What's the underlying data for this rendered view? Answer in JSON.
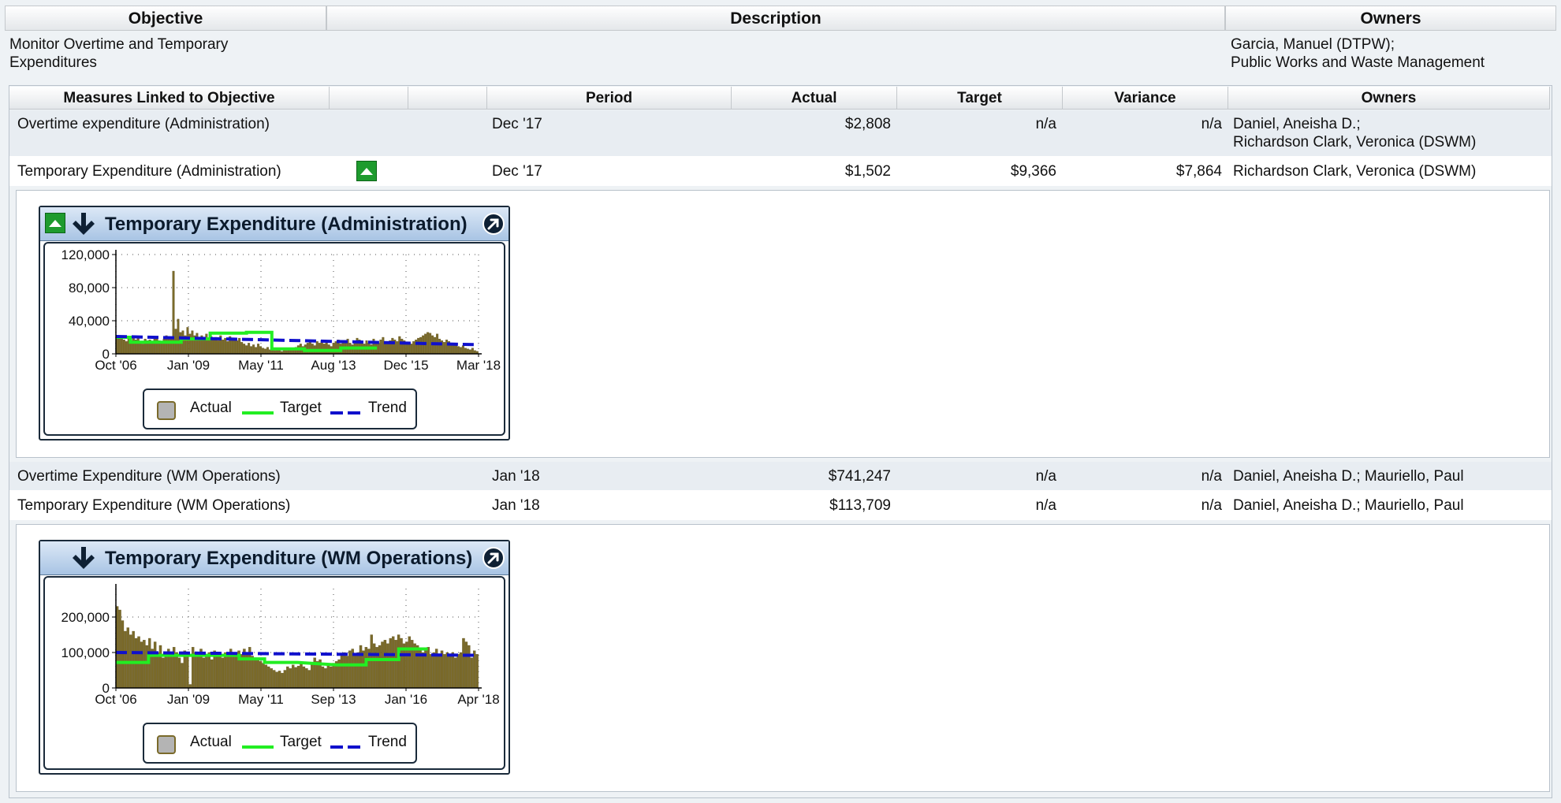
{
  "objective_table": {
    "headers": {
      "objective": "Objective",
      "description": "Description",
      "owners": "Owners"
    },
    "objective": "Monitor Overtime and Temporary Expenditures",
    "objective_line1": "Monitor Overtime and Temporary",
    "objective_line2": "Expenditures",
    "description": "",
    "owners_line1": "Garcia, Manuel (DTPW);",
    "owners_line2": "Public Works and Waste Management"
  },
  "measures_table": {
    "headers": {
      "measure": "Measures Linked to Objective",
      "period": "Period",
      "actual": "Actual",
      "target": "Target",
      "variance": "Variance",
      "owners": "Owners"
    },
    "rows": [
      {
        "measure": "Overtime expenditure (Administration)",
        "period": "Dec '17",
        "actual": "$2,808",
        "target": "n/a",
        "variance": "n/a",
        "owners_line1": "Daniel, Aneisha D.;",
        "owners_line2": "Richardson Clark, Veronica (DSWM)",
        "status": "none"
      },
      {
        "measure": "Temporary Expenditure (Administration)",
        "period": "Dec '17",
        "actual": "$1,502",
        "target": "$9,366",
        "variance": "$7,864",
        "owners_line1": "Richardson Clark, Veronica (DSWM)",
        "owners_line2": "",
        "status": "up-green"
      },
      {
        "measure": "Overtime Expenditure (WM Operations)",
        "period": "Jan '18",
        "actual": "$741,247",
        "target": "n/a",
        "variance": "n/a",
        "owners_line1": "Daniel, Aneisha D.; Mauriello, Paul",
        "owners_line2": "",
        "status": "none"
      },
      {
        "measure": "Temporary Expenditure (WM Operations)",
        "period": "Jan '18",
        "actual": "$113,709",
        "target": "n/a",
        "variance": "n/a",
        "owners_line1": "Daniel, Aneisha D.; Mauriello, Paul",
        "owners_line2": "",
        "status": "none"
      }
    ]
  },
  "widgets": [
    {
      "title": "Temporary Expenditure (Administration)",
      "status_icon": "up-green-icon",
      "trend_icon": "down-arrow-icon",
      "link_icon": "expand-arrow-icon"
    },
    {
      "title": "Temporary Expenditure (WM Operations)",
      "status_icon": "",
      "trend_icon": "down-arrow-icon",
      "link_icon": "expand-arrow-icon"
    }
  ],
  "legend": {
    "actual": "Actual",
    "target": "Target",
    "trend": "Trend"
  },
  "colors": {
    "actual_fill": "#7a6a2a",
    "actual_stroke": "#5e5120",
    "target": "#22ee22",
    "trend": "#1010cc",
    "status_green": "#1e9b2e"
  },
  "chart_data": [
    {
      "type": "bar",
      "title": "Temporary Expenditure (Administration)",
      "x_tick_labels": [
        "Oct '06",
        "Jan '09",
        "May '11",
        "Aug '13",
        "Dec '15",
        "Mar '18"
      ],
      "y_tick_labels": [
        "0",
        "40,000",
        "80,000",
        "120,000"
      ],
      "ylim": [
        0,
        120000
      ],
      "grid": true,
      "legend_position": "bottom",
      "series": [
        {
          "name": "Actual",
          "kind": "bar",
          "values": [
            21000,
            19000,
            22000,
            17000,
            15000,
            18000,
            16000,
            19000,
            17000,
            20000,
            14000,
            12000,
            18000,
            16000,
            17000,
            15000,
            19000,
            21000,
            16000,
            14000,
            18000,
            22000,
            20000,
            19000,
            100000,
            30000,
            42000,
            26000,
            28000,
            22000,
            32000,
            24000,
            28000,
            22000,
            25000,
            18000,
            22000,
            20000,
            24000,
            19000,
            21000,
            18000,
            20000,
            16000,
            22000,
            17000,
            19000,
            15000,
            21000,
            18000,
            17000,
            16000,
            19000,
            14000,
            12000,
            10000,
            13000,
            9000,
            11000,
            8000,
            12000,
            9000,
            7000,
            6000,
            8000,
            5000,
            6000,
            4000,
            7000,
            5000,
            3000,
            6000,
            4000,
            5000,
            7000,
            6000,
            8000,
            10000,
            12000,
            9000,
            11000,
            13000,
            14000,
            12000,
            10000,
            15000,
            13000,
            16000,
            12000,
            14000,
            11000,
            9000,
            13000,
            15000,
            17000,
            12000,
            14000,
            16000,
            18000,
            13000,
            11000,
            15000,
            19000,
            17000,
            14000,
            12000,
            16000,
            13000,
            11000,
            18000,
            15000,
            13000,
            17000,
            20000,
            14000,
            12000,
            16000,
            19000,
            17000,
            15000,
            21000,
            18000,
            16000,
            14000,
            13000,
            12000,
            15000,
            17000,
            19000,
            20000,
            22000,
            24000,
            26000,
            25000,
            22000,
            20000,
            24000,
            18000,
            16000,
            14000,
            17000,
            15000,
            13000,
            12000,
            11000,
            9000,
            8000,
            10000,
            7000,
            6000,
            5000,
            7000,
            4000,
            3000
          ]
        },
        {
          "name": "Target",
          "kind": "step-line",
          "points": [
            [
              0,
              20000
            ],
            [
              0.04,
              20000
            ],
            [
              0.04,
              14000
            ],
            [
              0.18,
              14000
            ],
            [
              0.18,
              18000
            ],
            [
              0.26,
              18000
            ],
            [
              0.26,
              25000
            ],
            [
              0.36,
              25000
            ],
            [
              0.36,
              26000
            ],
            [
              0.43,
              26000
            ],
            [
              0.43,
              6000
            ],
            [
              0.52,
              6000
            ],
            [
              0.52,
              4000
            ],
            [
              0.62,
              4000
            ],
            [
              0.62,
              7000
            ],
            [
              0.72,
              7000
            ]
          ]
        },
        {
          "name": "Trend",
          "kind": "dashed-line",
          "points": [
            [
              0,
              21000
            ],
            [
              1,
              11000
            ]
          ]
        }
      ]
    },
    {
      "type": "bar",
      "title": "Temporary Expenditure (WM Operations)",
      "x_tick_labels": [
        "Oct '06",
        "Jan '09",
        "May '11",
        "Sep '13",
        "Jan '16",
        "Apr '18"
      ],
      "y_tick_labels": [
        "0",
        "100,000",
        "200,000"
      ],
      "ylim": [
        0,
        280000
      ],
      "grid": true,
      "legend_position": "bottom",
      "series": [
        {
          "name": "Actual",
          "kind": "bar",
          "values": [
            230000,
            220000,
            190000,
            160000,
            170000,
            150000,
            160000,
            140000,
            145000,
            130000,
            135000,
            120000,
            140000,
            110000,
            130000,
            100000,
            120000,
            85000,
            95000,
            110000,
            90000,
            115000,
            100000,
            85000,
            70000,
            105000,
            95000,
            10000,
            115000,
            100000,
            90000,
            110000,
            85000,
            95000,
            100000,
            80000,
            105000,
            90000,
            95000,
            85000,
            100000,
            90000,
            110000,
            95000,
            100000,
            105000,
            95000,
            110000,
            100000,
            115000,
            90000,
            85000,
            80000,
            75000,
            70000,
            65000,
            60000,
            55000,
            50000,
            45000,
            48000,
            42000,
            50000,
            60000,
            55000,
            65000,
            58000,
            62000,
            70000,
            60000,
            55000,
            50000,
            70000,
            85000,
            75000,
            80000,
            60000,
            55000,
            65000,
            60000,
            70000,
            75000,
            80000,
            95000,
            100000,
            90000,
            105000,
            110000,
            95000,
            100000,
            120000,
            105000,
            115000,
            110000,
            150000,
            125000,
            115000,
            120000,
            130000,
            135000,
            125000,
            140000,
            145000,
            135000,
            150000,
            140000,
            125000,
            130000,
            145000,
            135000,
            125000,
            120000,
            110000,
            100000,
            105000,
            115000,
            95000,
            100000,
            110000,
            90000,
            105000,
            95000,
            100000,
            90000,
            100000,
            85000,
            95000,
            100000,
            140000,
            130000,
            120000,
            85000,
            105000,
            95000
          ]
        },
        {
          "name": "Target",
          "kind": "step-line",
          "points": [
            [
              0,
              72000
            ],
            [
              0.09,
              72000
            ],
            [
              0.09,
              92000
            ],
            [
              0.34,
              92000
            ],
            [
              0.34,
              82000
            ],
            [
              0.41,
              82000
            ],
            [
              0.41,
              72000
            ],
            [
              0.5,
              72000
            ],
            [
              0.61,
              65000
            ],
            [
              0.69,
              65000
            ],
            [
              0.69,
              80000
            ],
            [
              0.78,
              80000
            ],
            [
              0.78,
              110000
            ],
            [
              0.86,
              110000
            ]
          ]
        },
        {
          "name": "Trend",
          "kind": "dashed-line",
          "points": [
            [
              0,
              100000
            ],
            [
              1,
              92000
            ]
          ]
        }
      ]
    }
  ]
}
